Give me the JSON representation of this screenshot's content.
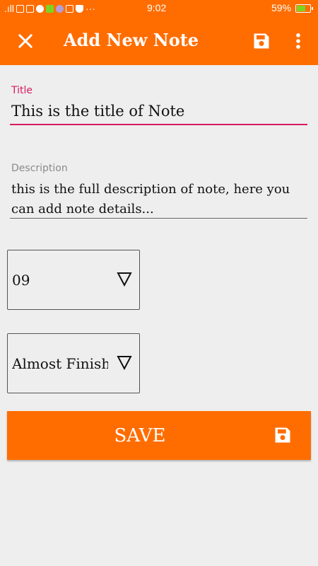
{
  "status_bar": {
    "signal_text": ".ıll",
    "time": "9:02",
    "battery_percent": "59%",
    "battery_level": 0.59,
    "more_icons": "···"
  },
  "app_bar": {
    "title": "Add New Note",
    "close_icon": "close-icon",
    "save_icon": "save-icon",
    "menu_icon": "more-vert-icon"
  },
  "form": {
    "title": {
      "label": "Title",
      "value": "This is the title of Note"
    },
    "description": {
      "label": "Description",
      "value": "this is the full description of note, here you can add note details..."
    },
    "spinner_number": {
      "selected": "09"
    },
    "spinner_status": {
      "selected": "Almost Finished"
    },
    "save_button": {
      "label": "SAVE"
    }
  },
  "colors": {
    "primary": "#ff6d00",
    "accent": "#d81b60",
    "background": "#eeeeee"
  }
}
